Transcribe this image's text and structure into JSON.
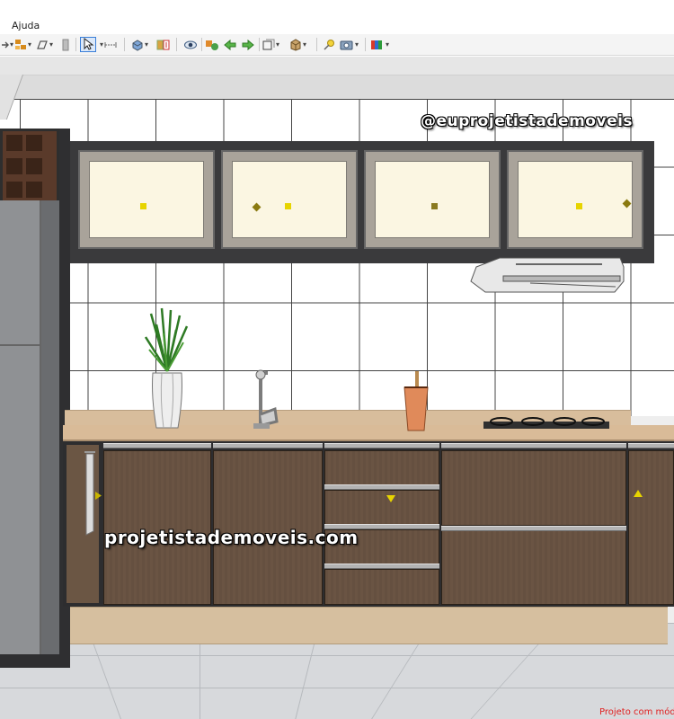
{
  "menu": {
    "help_label": "Ajuda"
  },
  "toolbar": {
    "icons": [
      "move-icon",
      "layers-icon",
      "rotate-icon",
      "panel-icon",
      "select-arrow-icon",
      "measure-icon",
      "material-icon",
      "split-view-icon",
      "eye-icon",
      "render-icon",
      "arrow-left-icon",
      "arrow-right-icon",
      "view-frame-icon",
      "box-icon",
      "light-icon",
      "camera-icon",
      "palette-icon"
    ],
    "selected_tool": "select-arrow-icon"
  },
  "viewport": {
    "watermark_handle": "@euprojetistademoveis",
    "watermark_site": "projetistademoveis.com",
    "footer_note": "Projeto com mód"
  },
  "colors": {
    "accent_selected": "#3b7fd8",
    "cabinet_frame": "#3a3a3c",
    "door_wood": "#6a5443",
    "countertop": "#d9bb98",
    "marker_yellow": "#e7d400",
    "footer_red": "#e02020"
  }
}
